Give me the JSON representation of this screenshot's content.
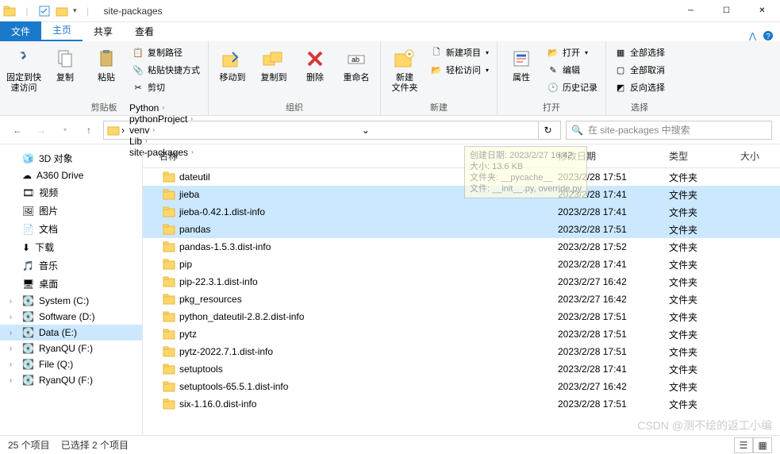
{
  "window": {
    "title": "site-packages"
  },
  "tabs": {
    "file": "文件",
    "home": "主页",
    "share": "共享",
    "view": "查看"
  },
  "ribbon": {
    "clipboard": {
      "label": "剪贴板",
      "pin": "固定到快\n速访问",
      "copy": "复制",
      "paste": "粘贴",
      "copy_path": "复制路径",
      "paste_shortcut": "粘贴快捷方式",
      "cut": "剪切"
    },
    "organize": {
      "label": "组织",
      "move": "移动到",
      "copyto": "复制到",
      "delete": "删除",
      "rename": "重命名"
    },
    "new": {
      "label": "新建",
      "newfolder": "新建\n文件夹",
      "newitem": "新建项目",
      "easyaccess": "轻松访问"
    },
    "open": {
      "label": "打开",
      "props": "属性",
      "open": "打开",
      "edit": "编辑",
      "history": "历史记录"
    },
    "select": {
      "label": "选择",
      "all": "全部选择",
      "none": "全部取消",
      "invert": "反向选择"
    }
  },
  "breadcrumbs": [
    "Python",
    "pythonProject",
    "venv",
    "Lib",
    "site-packages"
  ],
  "search": {
    "placeholder": "在 site-packages 中搜索"
  },
  "tree": [
    {
      "label": "3D 对象",
      "icon": "cube"
    },
    {
      "label": "A360 Drive",
      "icon": "cloud"
    },
    {
      "label": "视频",
      "icon": "video"
    },
    {
      "label": "图片",
      "icon": "picture"
    },
    {
      "label": "文档",
      "icon": "doc"
    },
    {
      "label": "下载",
      "icon": "download"
    },
    {
      "label": "音乐",
      "icon": "music"
    },
    {
      "label": "桌面",
      "icon": "desktop"
    },
    {
      "label": "System (C:)",
      "icon": "drive",
      "expandable": true
    },
    {
      "label": "Software (D:)",
      "icon": "drive",
      "expandable": true
    },
    {
      "label": "Data (E:)",
      "icon": "drive",
      "expandable": true,
      "selected": true
    },
    {
      "label": "RyanQU (F:)",
      "icon": "drive",
      "expandable": true
    },
    {
      "label": "File (Q:)",
      "icon": "drive",
      "expandable": true
    },
    {
      "label": "RyanQU (F:)",
      "icon": "drive",
      "expandable": true,
      "indent": 0
    }
  ],
  "columns": {
    "name": "名称",
    "date": "修改日期",
    "type": "类型",
    "size": "大小"
  },
  "rows": [
    {
      "name": "dateutil",
      "date": "2023/2/28 17:51",
      "type": "文件夹"
    },
    {
      "name": "jieba",
      "date": "2023/2/28 17:41",
      "type": "文件夹",
      "selected": true
    },
    {
      "name": "jieba-0.42.1.dist-info",
      "date": "2023/2/28 17:41",
      "type": "文件夹",
      "selected": true
    },
    {
      "name": "pandas",
      "date": "2023/2/28 17:51",
      "type": "文件夹",
      "selected": true
    },
    {
      "name": "pandas-1.5.3.dist-info",
      "date": "2023/2/28 17:52",
      "type": "文件夹"
    },
    {
      "name": "pip",
      "date": "2023/2/28 17:41",
      "type": "文件夹"
    },
    {
      "name": "pip-22.3.1.dist-info",
      "date": "2023/2/27 16:42",
      "type": "文件夹"
    },
    {
      "name": "pkg_resources",
      "date": "2023/2/27 16:42",
      "type": "文件夹"
    },
    {
      "name": "python_dateutil-2.8.2.dist-info",
      "date": "2023/2/28 17:51",
      "type": "文件夹"
    },
    {
      "name": "pytz",
      "date": "2023/2/28 17:51",
      "type": "文件夹"
    },
    {
      "name": "pytz-2022.7.1.dist-info",
      "date": "2023/2/28 17:51",
      "type": "文件夹"
    },
    {
      "name": "setuptools",
      "date": "2023/2/28 17:41",
      "type": "文件夹"
    },
    {
      "name": "setuptools-65.5.1.dist-info",
      "date": "2023/2/27 16:42",
      "type": "文件夹"
    },
    {
      "name": "six-1.16.0.dist-info",
      "date": "2023/2/28 17:51",
      "type": "文件夹"
    }
  ],
  "tooltip": {
    "line1": "创建日期: 2023/2/27 16:42",
    "line2": "大小: 13.6 KB",
    "line3": "文件夹: __pycache__",
    "line4": "文件: __init__.py, override.py"
  },
  "status": {
    "count": "25 个项目",
    "selected": "已选择 2 个项目"
  },
  "watermark": "CSDN @测不绘的返工小编"
}
